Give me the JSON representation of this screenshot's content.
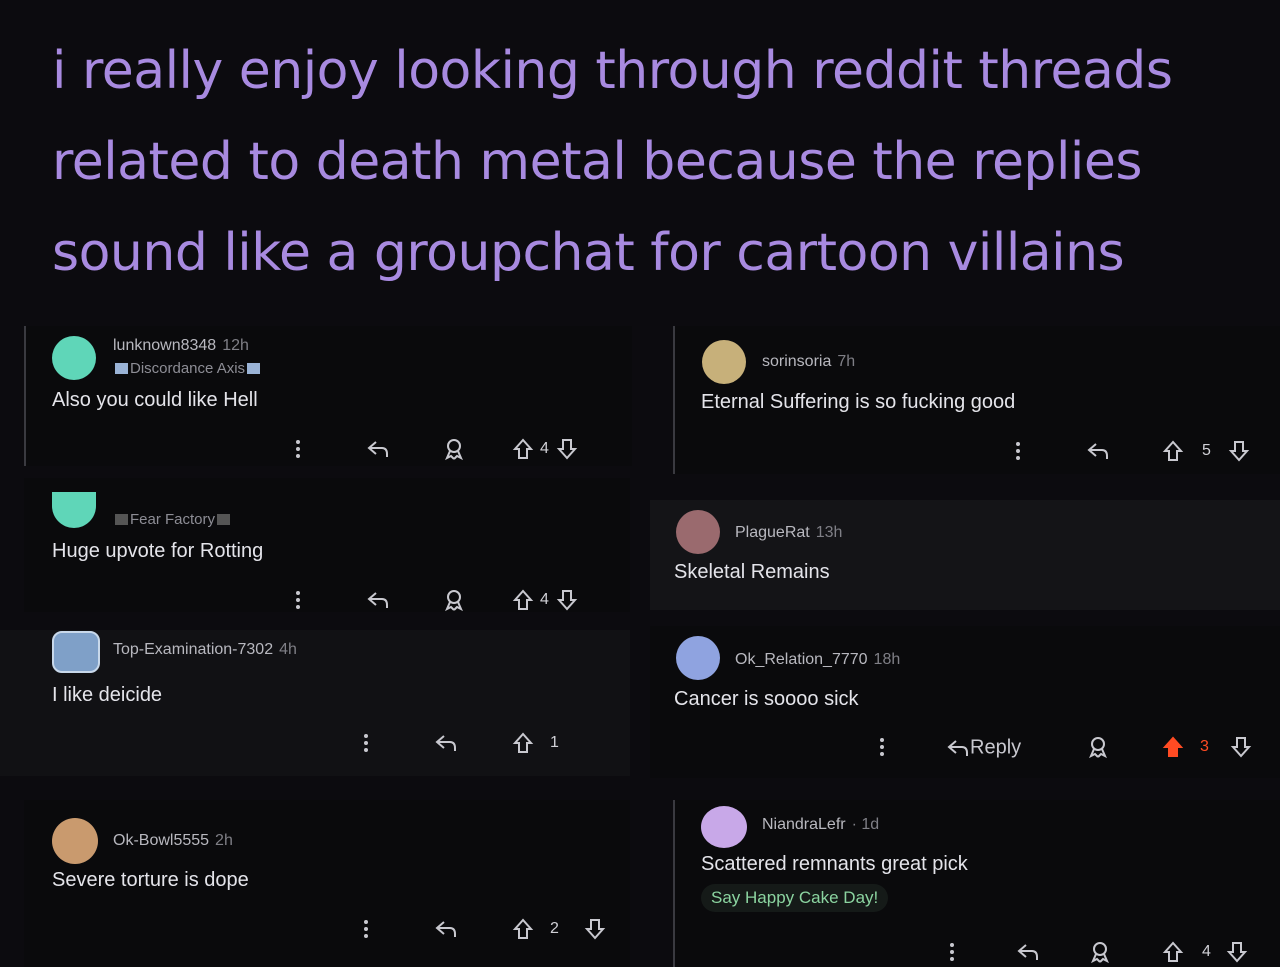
{
  "headline": {
    "line1": "i really enjoy looking through reddit threads",
    "line2": "related to death metal because the replies",
    "line3": "sound like a groupchat for cartoon villains"
  },
  "comments": [
    {
      "user": "lunknown8348",
      "time": "12h",
      "flair": "Discordance Axis",
      "text": "Also you could like Hell",
      "votes": "4",
      "avatar_color": "#5fd6b8"
    },
    {
      "user": "",
      "time": "",
      "flair": "Fear Factory",
      "text": "Huge upvote for Rotting",
      "votes": "4",
      "avatar_color": "#5fd6b8"
    },
    {
      "user": "Top-Examination-7302",
      "time": "4h",
      "text": "I like deicide",
      "votes": "1",
      "avatar_color": "#7fa0c8"
    },
    {
      "user": "Ok-Bowl5555",
      "time": "2h",
      "text": "Severe torture is dope",
      "votes": "2",
      "avatar_color": "#c99a6e"
    },
    {
      "user": "sorinsoria",
      "time": "7h",
      "text": "Eternal Suffering is so fucking good",
      "votes": "5",
      "avatar_color": "#c7b07a"
    },
    {
      "user": "PlagueRat",
      "time": "13h",
      "text": "Skeletal Remains",
      "avatar_color": "#9a6a6e"
    },
    {
      "user": "Ok_Relation_7770",
      "time": "18h",
      "text": "Cancer is soooo sick",
      "votes": "3",
      "reply_label": "Reply",
      "avatar_color": "#8fa3e0",
      "upvote_color": "#ff4b23"
    },
    {
      "user": "NiandraLefr",
      "time": "· 1d",
      "text": "Scattered remnants great pick",
      "cake": "Say Happy Cake Day!",
      "votes": "4",
      "avatar_color": "#c8a8e8"
    }
  ]
}
